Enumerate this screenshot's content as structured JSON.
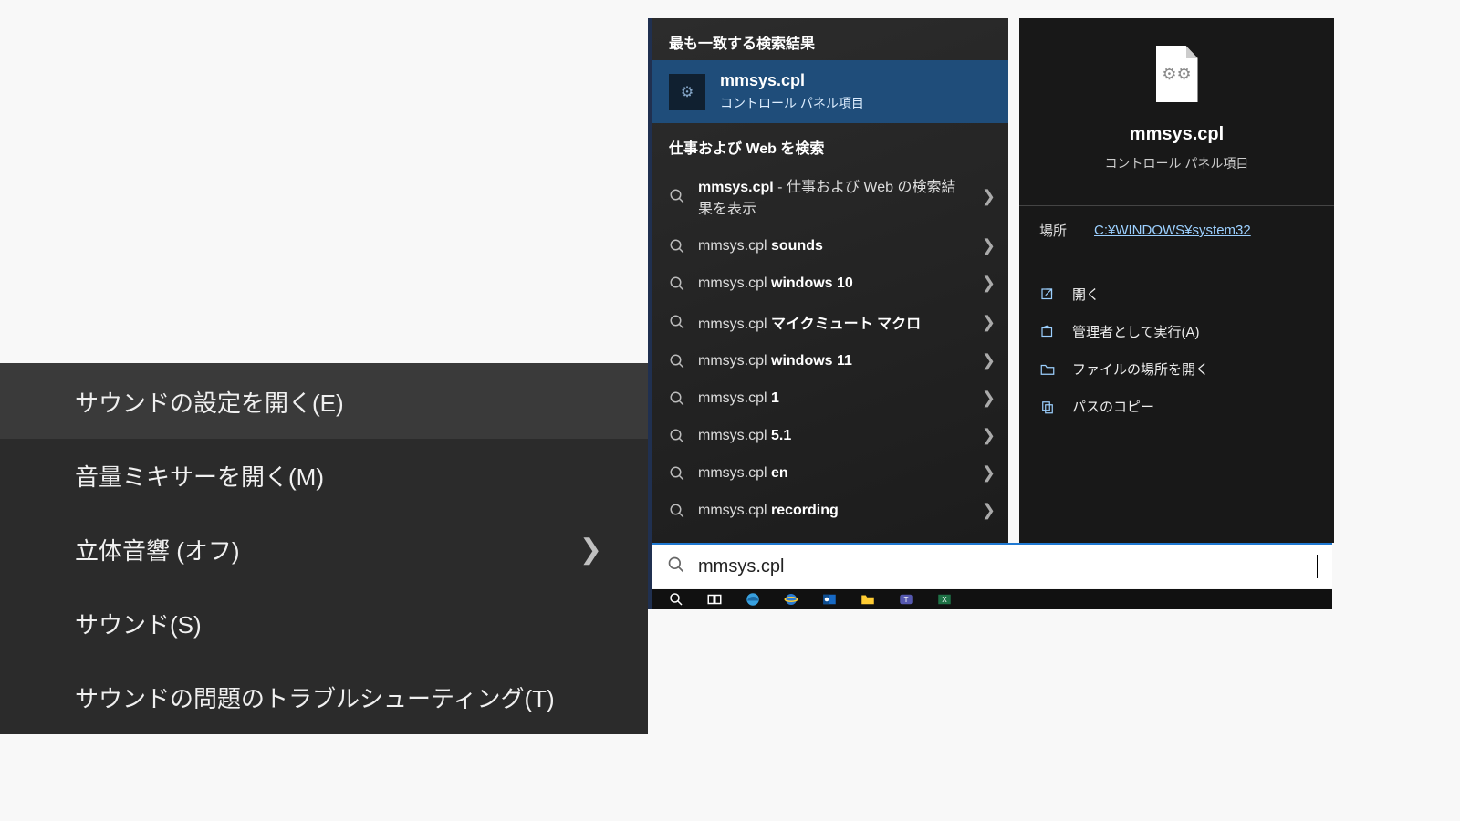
{
  "context_menu": {
    "items": [
      {
        "label": "サウンドの設定を開く(E)",
        "has_submenu": false,
        "highlight": true
      },
      {
        "label": "音量ミキサーを開く(M)",
        "has_submenu": false,
        "highlight": false
      },
      {
        "label": "立体音響 (オフ)",
        "has_submenu": true,
        "highlight": false
      },
      {
        "label": "サウンド(S)",
        "has_submenu": false,
        "highlight": false
      },
      {
        "label": "サウンドの問題のトラブルシューティング(T)",
        "has_submenu": false,
        "highlight": false
      }
    ]
  },
  "search": {
    "sections": {
      "best_match_header": "最も一致する検索結果",
      "web_header": "仕事および Web を検索"
    },
    "best_match": {
      "title": "mmsys.cpl",
      "subtitle": "コントロール パネル項目"
    },
    "suggestions": [
      {
        "prefix": "mmsys.cpl",
        "suffix": " - 仕事および Web の検索結果を表示"
      },
      {
        "prefix": "mmsys.cpl ",
        "suffix": "sounds"
      },
      {
        "prefix": "mmsys.cpl ",
        "suffix": "windows 10"
      },
      {
        "prefix": "mmsys.cpl ",
        "suffix": "マイクミュート マクロ"
      },
      {
        "prefix": "mmsys.cpl ",
        "suffix": "windows 11"
      },
      {
        "prefix": "mmsys.cpl ",
        "suffix": "1"
      },
      {
        "prefix": "mmsys.cpl ",
        "suffix": "5.1"
      },
      {
        "prefix": "mmsys.cpl ",
        "suffix": "en"
      },
      {
        "prefix": "mmsys.cpl ",
        "suffix": "recording"
      }
    ],
    "preview": {
      "title": "mmsys.cpl",
      "subtitle": "コントロール パネル項目",
      "location_label": "場所",
      "location_value": "C:¥WINDOWS¥system32",
      "actions": [
        {
          "icon": "open",
          "label": "開く"
        },
        {
          "icon": "admin",
          "label": "管理者として実行(A)"
        },
        {
          "icon": "folder",
          "label": "ファイルの場所を開く"
        },
        {
          "icon": "copy",
          "label": "パスのコピー"
        }
      ]
    },
    "input_value": "mmsys.cpl"
  },
  "taskbar": {
    "items": [
      "search",
      "taskview",
      "edge",
      "ie",
      "outlook",
      "explorer",
      "teams",
      "excel"
    ]
  }
}
